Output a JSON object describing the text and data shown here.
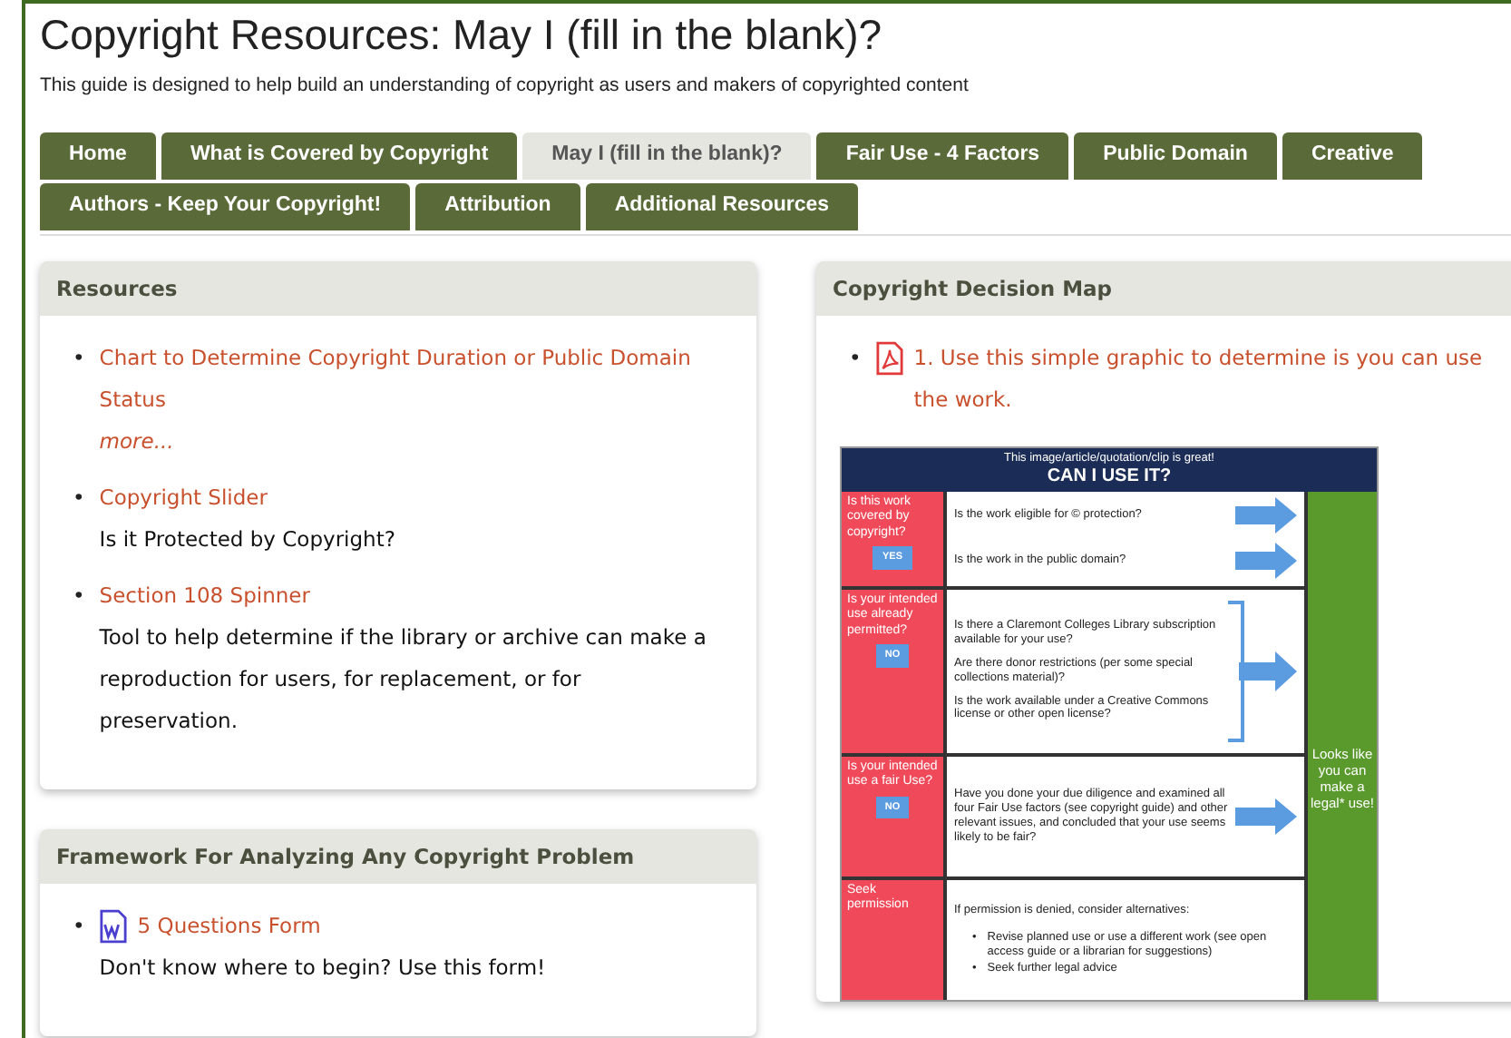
{
  "title": "Copyright Resources: May I (fill in the blank)?",
  "subtitle": "This guide is designed to help build an understanding of copyright as users and makers of copyrighted content",
  "tab_rows": [
    [
      {
        "label": "Home",
        "selected": false
      },
      {
        "label": "What is Covered by Copyright",
        "selected": false
      },
      {
        "label": "May I (fill in the blank)?",
        "selected": true
      },
      {
        "label": "Fair Use - 4 Factors",
        "selected": false
      },
      {
        "label": "Public Domain",
        "selected": false
      },
      {
        "label": "Creative",
        "selected": false
      }
    ],
    [
      {
        "label": "Authors - Keep Your Copyright!",
        "selected": false
      },
      {
        "label": "Attribution",
        "selected": false
      },
      {
        "label": "Additional Resources",
        "selected": false
      }
    ]
  ],
  "left_panels": [
    {
      "title": "Resources",
      "items": [
        {
          "bullet": "•",
          "kind": "link",
          "link": "Chart to Determine Copyright Duration or Public Domain Status",
          "more": "more..."
        },
        {
          "bullet": "•",
          "kind": "link",
          "link": "Copyright Slider",
          "description": "Is it Protected by Copyright?"
        },
        {
          "bullet": "•",
          "kind": "link",
          "link": "Section 108 Spinner",
          "description": "Tool to help determine if the library or archive can make a reproduction for users, for replacement, or for preservation."
        }
      ]
    },
    {
      "title": "Framework For Analyzing Any Copyright Problem",
      "items": [
        {
          "bullet": "•",
          "kind": "word",
          "link": "5 Questions Form",
          "description": "Don't know where to begin? Use this form!"
        }
      ]
    }
  ],
  "right_panel": {
    "title": "Copyright Decision Map",
    "items": [
      {
        "bullet": "•",
        "kind": "pdf",
        "link": "1. Use this simple graphic to determine is you can use the work."
      }
    ],
    "graphic": {
      "heading": "This image/article/quotation/clip is great!",
      "title": "CAN I USE IT?",
      "rows": [
        {
          "kind": "each",
          "question": "Is this work covered by copyright?",
          "badge": "YES",
          "items": [
            "Is the work eligible for © protection?",
            "Is the work in the public domain?"
          ]
        },
        {
          "kind": "bracket",
          "question": "Is your intended use already permitted?",
          "badge": "NO",
          "items": [
            "Is there a Claremont Colleges Library subscription available for your use?",
            "Are there donor restrictions (per some special collections material)?",
            "Is the work available under a Creative Commons license or other open license?"
          ]
        },
        {
          "kind": "single",
          "question": "Is your intended use a fair Use?",
          "badge": "NO",
          "items": [
            "Have you done your due diligence and examined all four Fair Use factors (see copyright guide) and other relevant issues, and concluded that your use seems likely to be fair?"
          ]
        },
        {
          "kind": "alternatives",
          "question": "Seek permission",
          "intro": "If permission is denied, consider alternatives:",
          "bullets": [
            {
              "bullet": "•",
              "text": "Revise planned use or use a different work (see open access guide or a librarian for suggestions)"
            },
            {
              "bullet": "•",
              "text": "Seek further legal advice"
            }
          ]
        }
      ],
      "result": "Looks like you can make a legal* use!"
    }
  }
}
